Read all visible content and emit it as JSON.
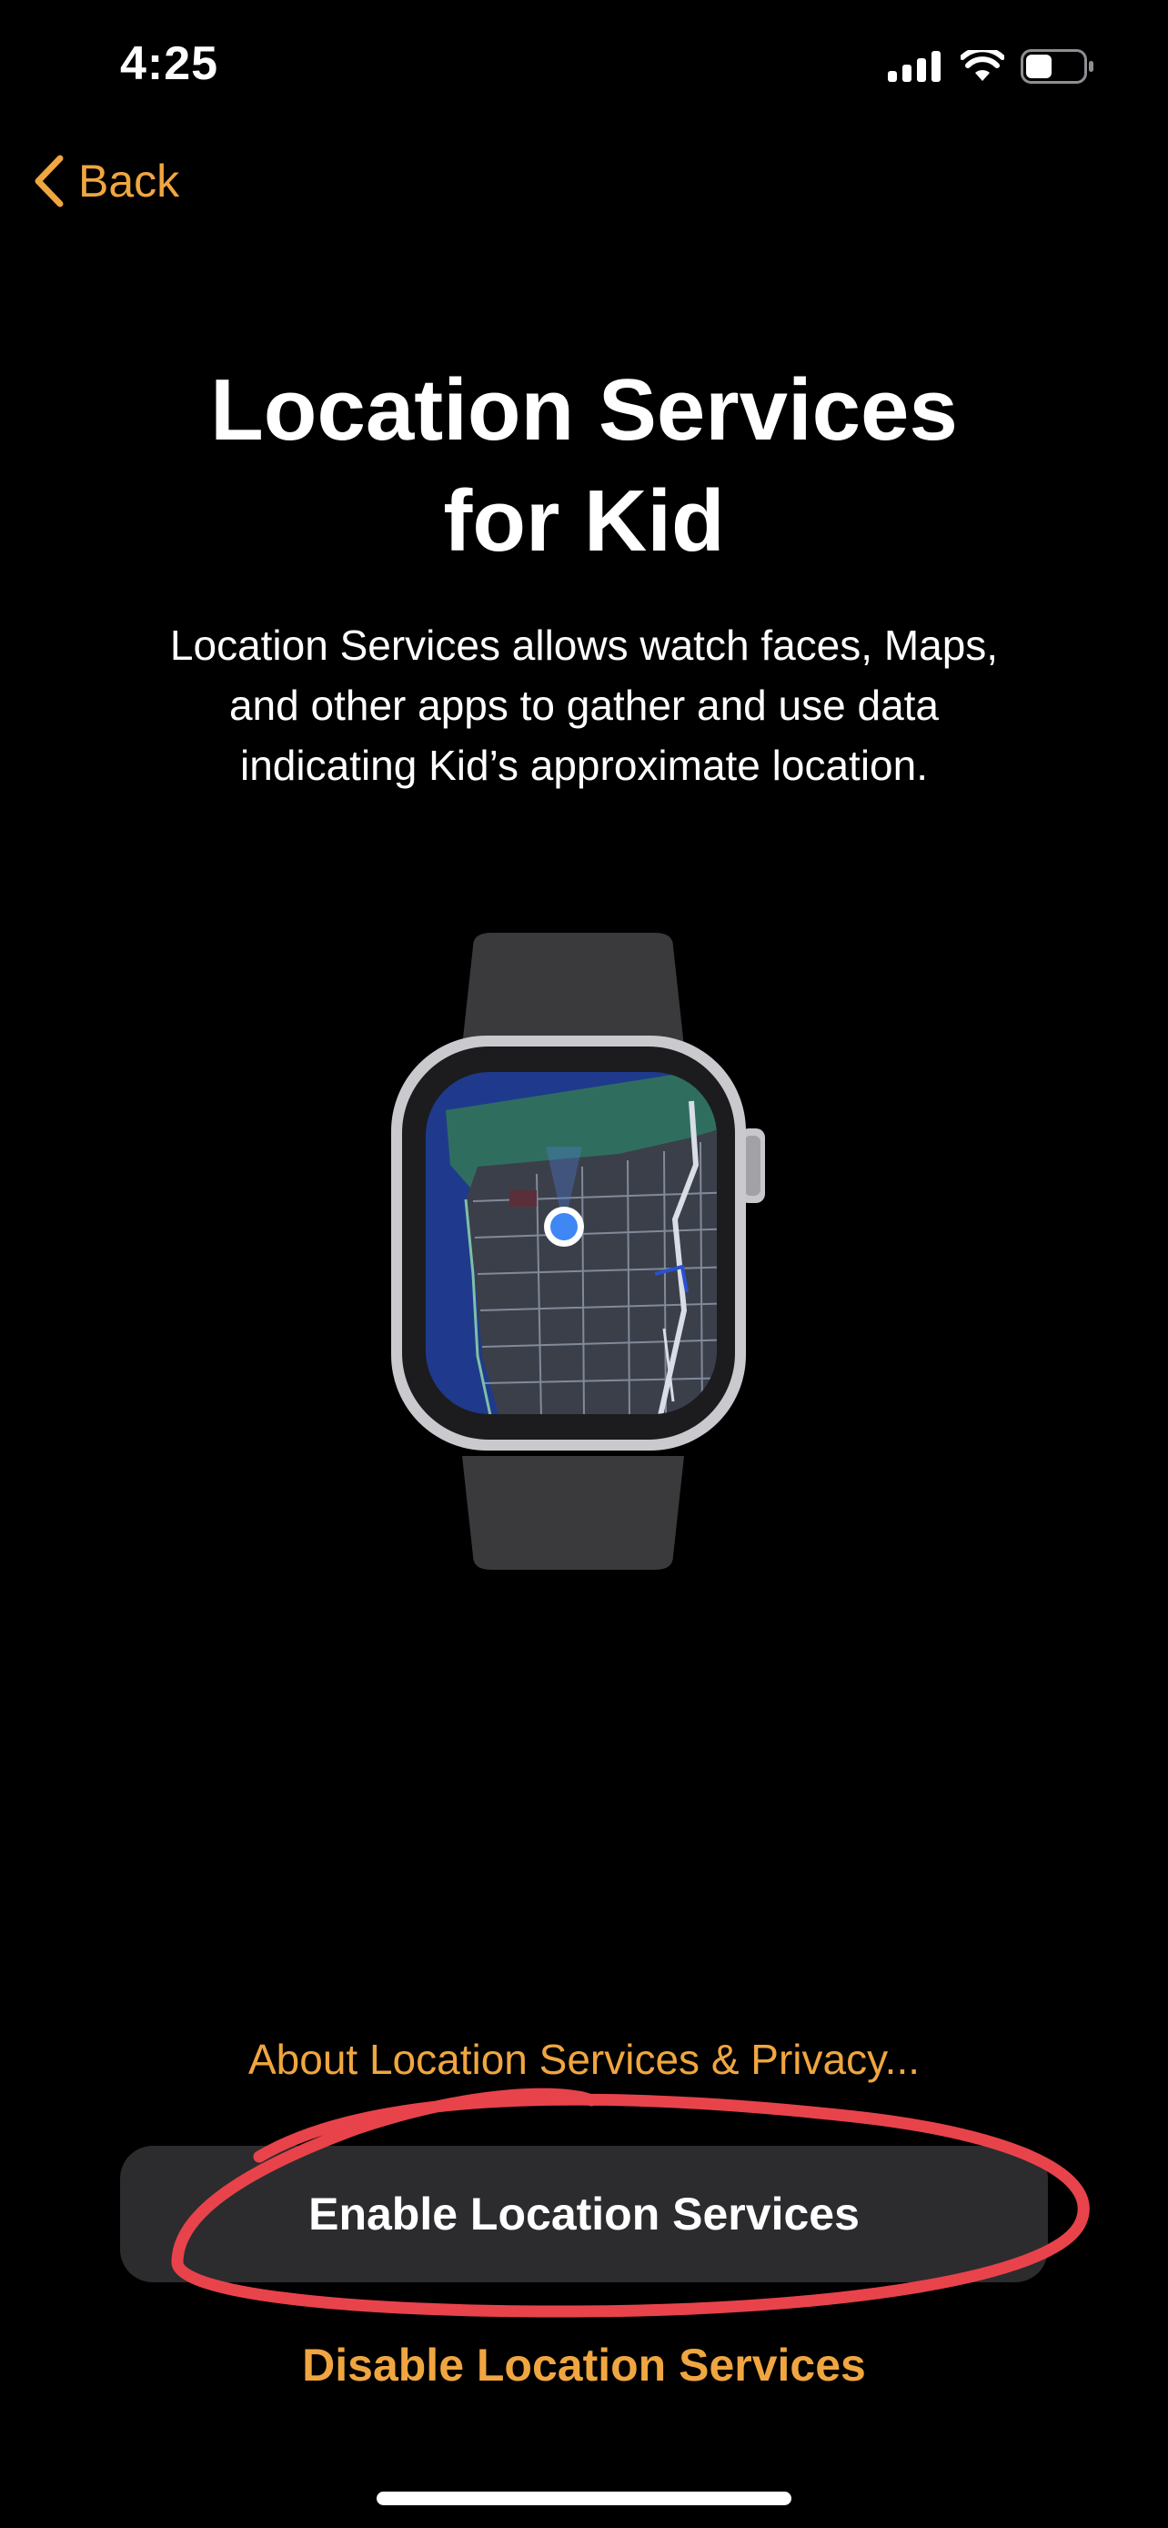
{
  "status_bar": {
    "time": "4:25",
    "icons": [
      "cellular-signal-icon",
      "wifi-icon",
      "battery-icon"
    ],
    "battery_level": 0.45
  },
  "nav": {
    "back_label": "Back",
    "back_icon": "chevron-left-icon"
  },
  "header": {
    "title_line1": "Location Services",
    "title_line2": "for Kid",
    "description_line1": "Location Services allows watch faces, Maps,",
    "description_line2": "and other apps to gather and use data",
    "description_line3": "indicating Kid’s approximate location."
  },
  "illustration": {
    "icon": "apple-watch-map-icon"
  },
  "actions": {
    "privacy_link": "About Location Services & Privacy...",
    "enable_button": "Enable Location Services",
    "disable_link": "Disable Location Services"
  },
  "colors": {
    "accent": "#f0a640",
    "background": "#000000",
    "button_background": "#2c2c2e",
    "annotation": "#e8434b"
  }
}
